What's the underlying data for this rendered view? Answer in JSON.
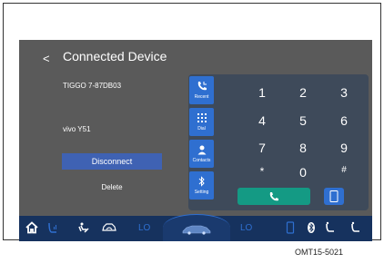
{
  "header": {
    "back_glyph": "<",
    "title": "Connected Device"
  },
  "devices": {
    "first": "TIGGO 7-87DB03",
    "second": "vivo Y51"
  },
  "actions": {
    "disconnect": "Disconnect",
    "delete": "Delete"
  },
  "side_menu": {
    "recent": "Recent",
    "dial": "Dial",
    "contacts": "Contacts",
    "setting": "Setting"
  },
  "keypad": [
    "1",
    "2",
    "3",
    "4",
    "5",
    "6",
    "7",
    "8",
    "9",
    "*",
    "0",
    "#"
  ],
  "bottom_bar": {
    "lo_left": "LO",
    "lo_right": "LO"
  },
  "caption": "OMT15-5021",
  "colors": {
    "accent": "#2f6fd0",
    "call": "#149a84",
    "bar": "#16325e"
  }
}
